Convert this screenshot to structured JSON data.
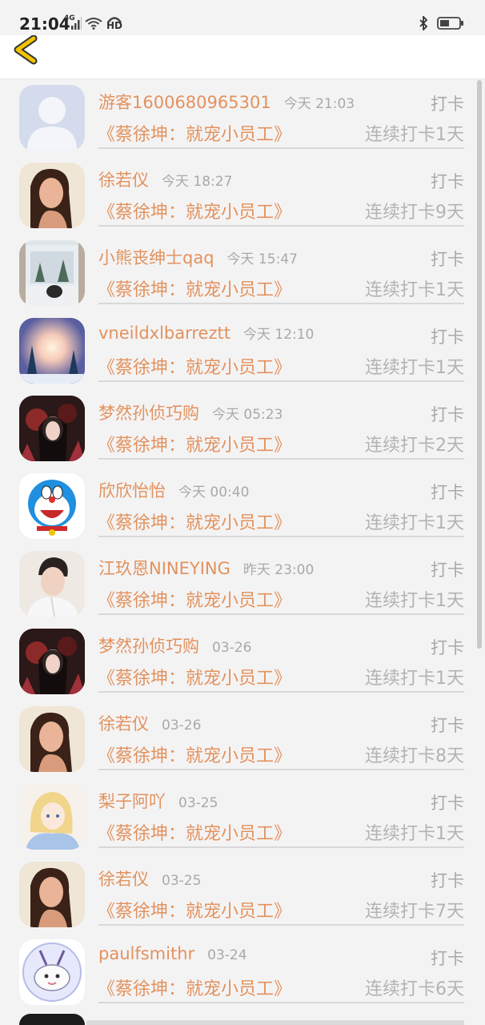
{
  "status_bar": {
    "time": "21:04",
    "network": "4G",
    "hd": "HD",
    "icons": [
      "signal-icon",
      "wifi-icon",
      "hd-call-icon",
      "bluetooth-icon",
      "battery-icon"
    ]
  },
  "header": {
    "back_icon": "chevron-left-icon",
    "accent": "#f2c300"
  },
  "colors": {
    "name": "#e2925d",
    "meta": "#a9a9a9",
    "background": "#f4f3f4"
  },
  "entries": [
    {
      "name": "游客1600680965301",
      "time": "今天 21:03",
      "action": "打卡",
      "course": "《蔡徐坤：就宠小员工》",
      "streak": "连续打卡1天",
      "avatar": "default-person-avatar"
    },
    {
      "name": "徐若仪",
      "time": "今天 18:27",
      "action": "打卡",
      "course": "《蔡徐坤：就宠小员工》",
      "streak": "连续打卡9天",
      "avatar": "woman-portrait-avatar"
    },
    {
      "name": "小熊丧绅士qaq",
      "time": "今天 15:47",
      "action": "打卡",
      "course": "《蔡徐坤：就宠小员工》",
      "streak": "连续打卡1天",
      "avatar": "snowy-window-avatar"
    },
    {
      "name": "vneildxlbarreztt",
      "time": "今天 12:10",
      "action": "打卡",
      "course": "《蔡徐坤：就宠小员工》",
      "streak": "连续打卡1天",
      "avatar": "winter-sunset-avatar"
    },
    {
      "name": "梦然孙侦巧购",
      "time": "今天 05:23",
      "action": "打卡",
      "course": "《蔡徐坤：就宠小员工》",
      "streak": "连续打卡2天",
      "avatar": "dark-art-avatar"
    },
    {
      "name": "欣欣怡怡",
      "time": "今天 00:40",
      "action": "打卡",
      "course": "《蔡徐坤：就宠小员工》",
      "streak": "连续打卡1天",
      "avatar": "doraemon-avatar"
    },
    {
      "name": "江玖恩NINEYING",
      "time": "昨天 23:00",
      "action": "打卡",
      "course": "《蔡徐坤：就宠小员工》",
      "streak": "连续打卡1天",
      "avatar": "man-portrait-avatar"
    },
    {
      "name": "梦然孙侦巧购",
      "time": "03-26",
      "action": "打卡",
      "course": "《蔡徐坤：就宠小员工》",
      "streak": "连续打卡1天",
      "avatar": "dark-art-avatar"
    },
    {
      "name": "徐若仪",
      "time": "03-26",
      "action": "打卡",
      "course": "《蔡徐坤：就宠小员工》",
      "streak": "连续打卡8天",
      "avatar": "woman-portrait-avatar"
    },
    {
      "name": "梨子阿吖",
      "time": "03-25",
      "action": "打卡",
      "course": "《蔡徐坤：就宠小员工》",
      "streak": "连续打卡1天",
      "avatar": "anime-girl-avatar"
    },
    {
      "name": "徐若仪",
      "time": "03-25",
      "action": "打卡",
      "course": "《蔡徐坤：就宠小员工》",
      "streak": "连续打卡7天",
      "avatar": "woman-portrait-avatar"
    },
    {
      "name": "paulfsmithr",
      "time": "03-24",
      "action": "打卡",
      "course": "《蔡徐坤：就宠小员工》",
      "streak": "连续打卡6天",
      "avatar": "cartoon-bunny-avatar"
    }
  ]
}
